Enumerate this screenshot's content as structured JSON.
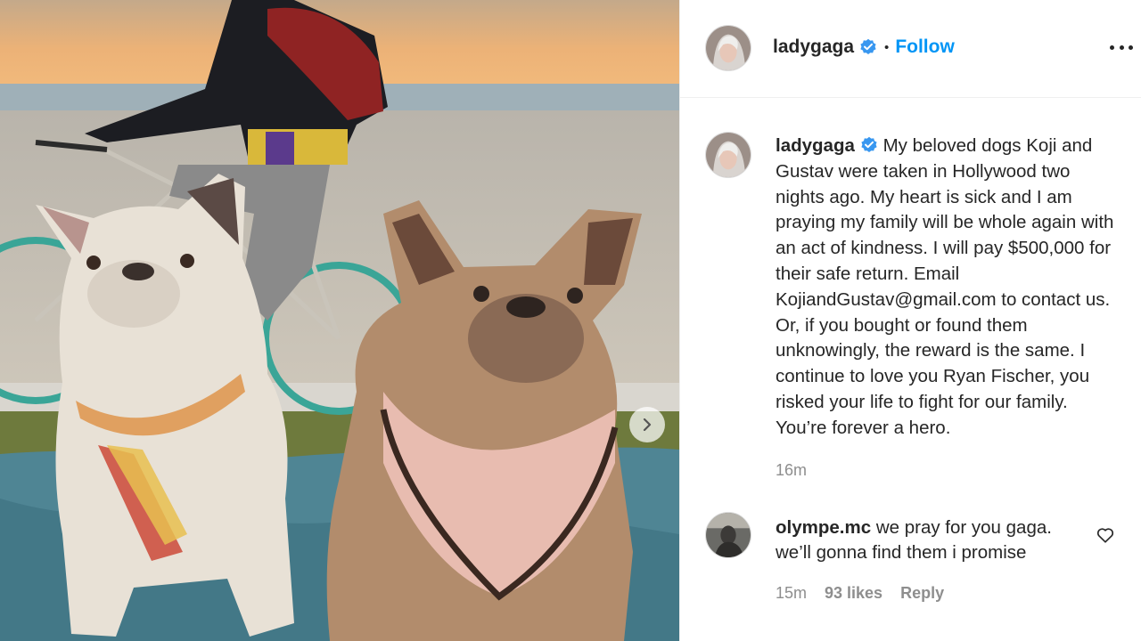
{
  "post": {
    "author": "ladygaga",
    "follow_label": "Follow",
    "separator": "•",
    "more_icon": "more-horizontal-icon",
    "verified_icon": "verified-badge-icon",
    "next_icon": "chevron-right-icon",
    "caption": "My beloved dogs Koji and Gustav were taken in Hollywood two nights ago. My heart is sick and I am praying my family will be whole again with an act of kindness. I will pay $500,000 for their safe return. Email KojiandGustav@gmail.com to contact us. Or, if you bought or found them unknowingly, the reward is the same. I continue to love you Ryan Fischer, you risked your life to fight for our family. You’re forever a hero.",
    "caption_time": "16m"
  },
  "comment": {
    "author": "olympe.mc",
    "text": "we pray for you gaga. we’ll gonna find them i promise",
    "time": "15m",
    "likes": "93 likes",
    "reply_label": "Reply",
    "like_icon": "heart-icon"
  },
  "colors": {
    "accent": "#0095f6",
    "text": "#262626",
    "secondary": "#8e8e8e",
    "divider": "#efefef"
  }
}
